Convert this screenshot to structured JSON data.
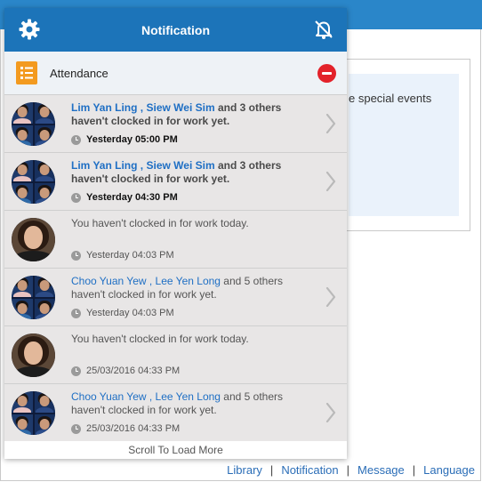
{
  "background": {
    "partial_text": "e special events",
    "footer_links": [
      "Library",
      "Notification",
      "Message",
      "Language"
    ]
  },
  "popup": {
    "title": "Notification",
    "section": {
      "title": "Attendance",
      "icon": "list-icon"
    },
    "notifications": [
      {
        "type": "group",
        "bold": true,
        "name1": "Lim Yan Ling",
        "sep": " , ",
        "name2": "Siew Wei Sim",
        "rest": " and 3 others haven't clocked in for work yet.",
        "time": "Yesterday 05:00 PM",
        "chevron": true
      },
      {
        "type": "group",
        "bold": true,
        "name1": "Lim Yan Ling",
        "sep": " , ",
        "name2": "Siew Wei Sim",
        "rest": " and 3 others haven't clocked in for work yet.",
        "time": "Yesterday 04:30 PM",
        "chevron": true
      },
      {
        "type": "self",
        "bold": false,
        "text": "You haven't clocked in for work today.",
        "time": "Yesterday 04:03 PM",
        "chevron": false
      },
      {
        "type": "group",
        "bold": false,
        "name1": "Choo Yuan Yew",
        "sep": " , ",
        "name2": "Lee Yen Long",
        "rest": " and 5 others haven't clocked in for work yet.",
        "time": "Yesterday 04:03 PM",
        "chevron": true
      },
      {
        "type": "self",
        "bold": false,
        "text": "You haven't clocked in for work today.",
        "time": "25/03/2016 04:33 PM",
        "chevron": false
      },
      {
        "type": "group",
        "bold": false,
        "name1": "Choo Yuan Yew",
        "sep": " , ",
        "name2": "Lee Yen Long",
        "rest": " and 5 others haven't clocked in for work yet.",
        "time": "25/03/2016 04:33 PM",
        "chevron": true
      }
    ],
    "load_more": "Scroll To Load More"
  },
  "colors": {
    "header": "#1c74b9",
    "link": "#1f6fc4",
    "row_bg": "#e8e6e6",
    "section_icon": "#f39a1f",
    "collapse": "#e3222a"
  }
}
